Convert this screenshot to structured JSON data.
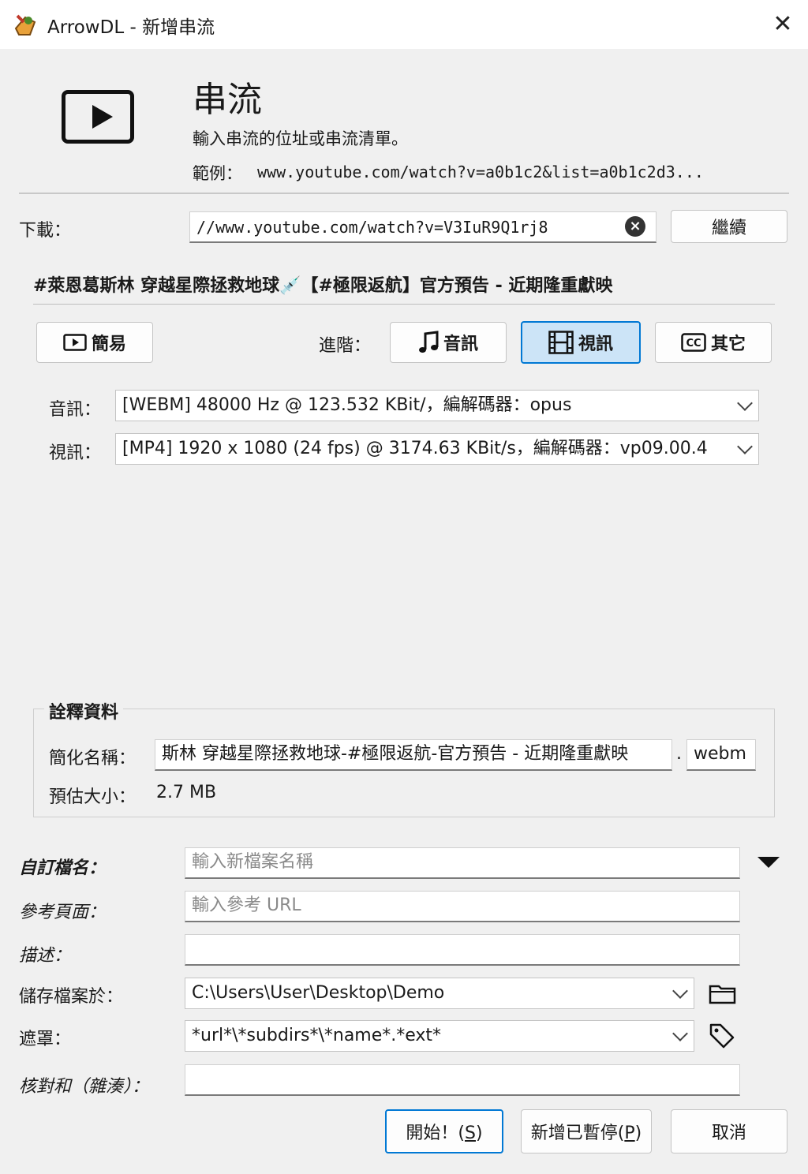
{
  "window": {
    "title": "ArrowDL - 新增串流",
    "close_glyph": "✕"
  },
  "header": {
    "title": "串流",
    "description": "輸入串流的位址或串流清單。",
    "example_label": "範例：",
    "example_value": "www.youtube.com/watch?v=a0b1c2&list=a0b1c2d3..."
  },
  "download": {
    "label": "下載：",
    "url_value": "//www.youtube.com/watch?v=V3IuR9Q1rj8",
    "continue_button": "繼續"
  },
  "stream_title": "#萊恩葛斯林 穿越星際拯救地球💉【#極限返航】官方預告 - 近期隆重獻映",
  "modes": {
    "simple_button": "簡易",
    "advanced_label": "進階：",
    "audio_button": "音訊",
    "video_button": "視訊",
    "other_button": "其它",
    "selected": "video"
  },
  "streams": {
    "audio_label": "音訊：",
    "audio_value": "[WEBM] 48000 Hz @ 123.532 KBit/，編解碼器：opus",
    "video_label": "視訊：",
    "video_value": "[MP4] 1920 x 1080 (24 fps) @ 3174.63 KBit/s，編解碼器：vp09.00.4"
  },
  "metadata": {
    "group_title": "詮釋資料",
    "name_label": "簡化名稱：",
    "name_value": "斯林 穿越星際拯救地球-#極限返航-官方預告 - 近期隆重獻映",
    "dot": ".",
    "extension": "webm",
    "size_label": "預估大小：",
    "size_value": "2.7 MB"
  },
  "options": {
    "custom_name_label": "自訂檔名：",
    "custom_name_placeholder": "輸入新檔案名稱",
    "referrer_label": "參考頁面：",
    "referrer_placeholder": "輸入參考 URL",
    "description_label": "描述：",
    "description_value": "",
    "save_label": "儲存檔案於：",
    "save_value": "C:\\Users\\User\\Desktop\\Demo",
    "mask_label": "遮罩：",
    "mask_value": "*url*\\*subdirs*\\*name*.*ext*",
    "checksum_label": "核對和（雜湊）：",
    "checksum_value": ""
  },
  "footer": {
    "start_text": "開始！(",
    "start_key": "S",
    "add_paused_text": "新增已暫停(",
    "add_paused_key": "P",
    "close_paren": ")",
    "cancel_button": "取消"
  },
  "colors": {
    "accent": "#0078d4",
    "selected_bg": "#cce4f7",
    "window_bg": "#f0f0f0"
  }
}
